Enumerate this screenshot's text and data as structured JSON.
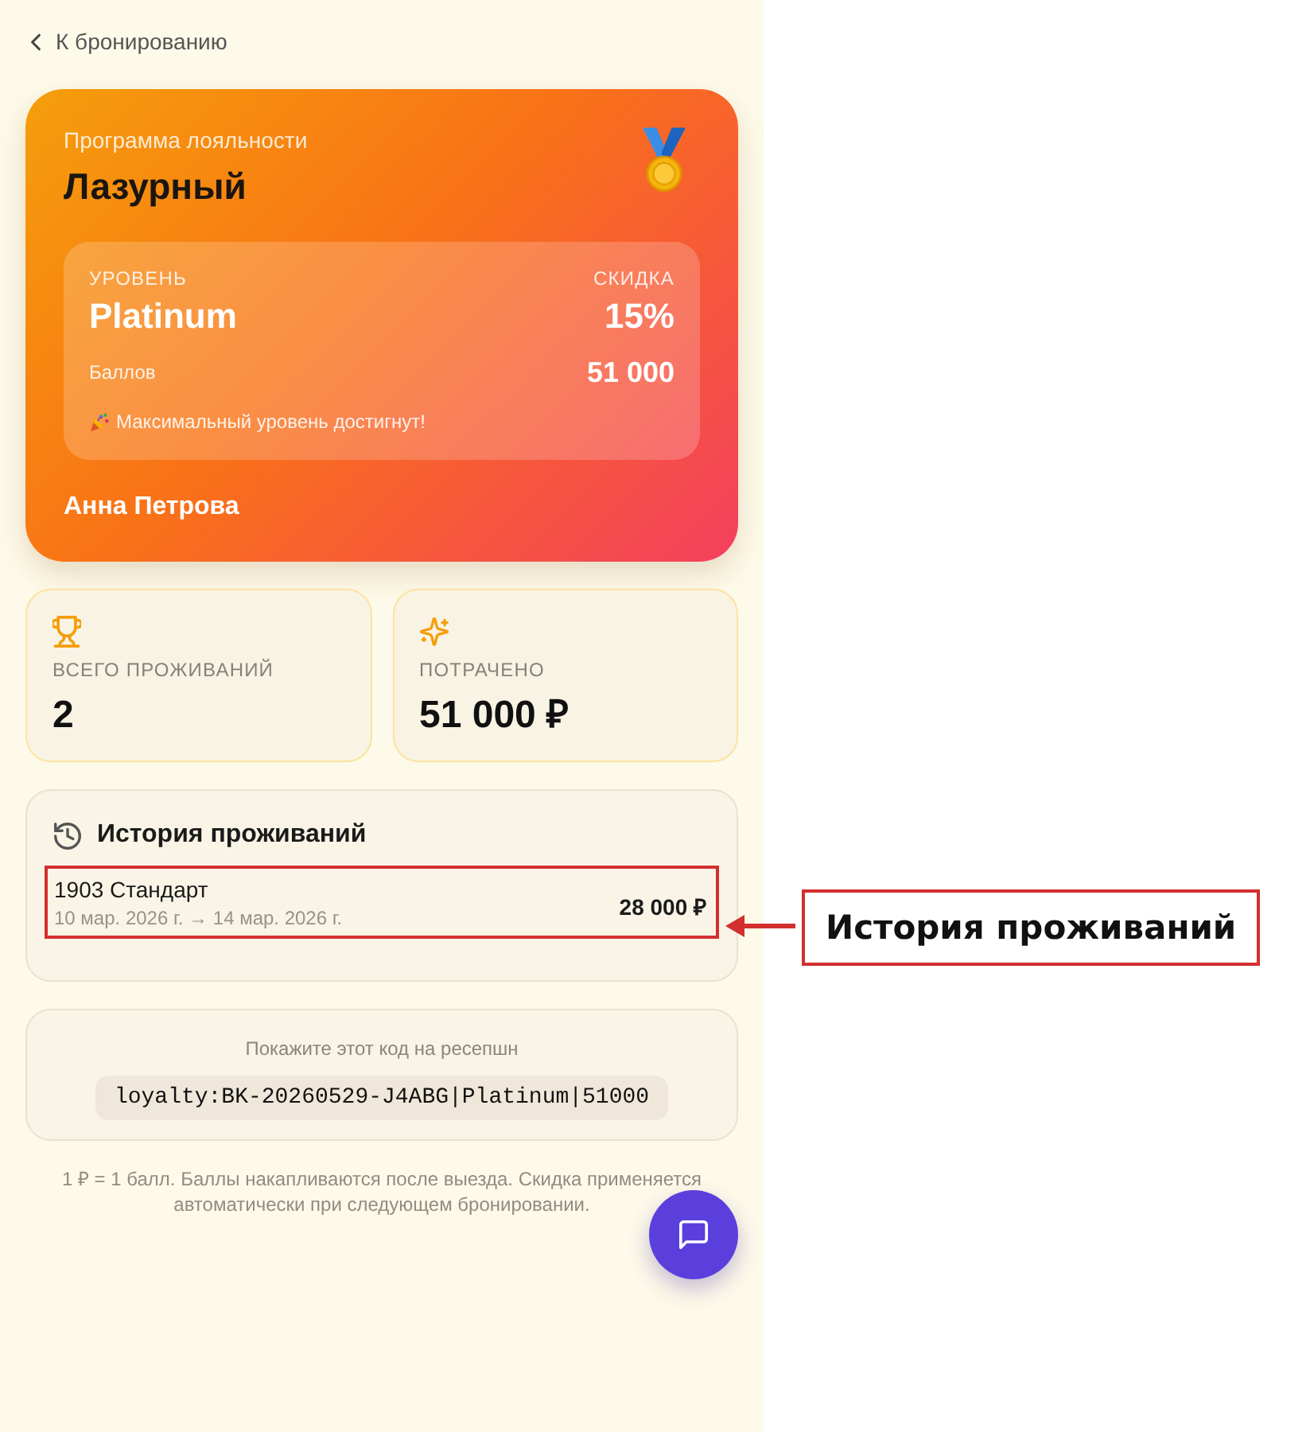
{
  "back_link": {
    "label": "К бронированию"
  },
  "loyalty_card": {
    "program_label": "Программа лояльности",
    "program_name": "Лазурный",
    "level_label": "УРОВЕНЬ",
    "level": "Platinum",
    "discount_label": "СКИДКА",
    "discount": "15%",
    "points_label": "Баллов",
    "points": "51 000",
    "status_message": "Максимальный уровень достигнут!",
    "holder_name": "Анна Петрова"
  },
  "stats": [
    {
      "kind": "trophy",
      "label": "ВСЕГО ПРОЖИВАНИЙ",
      "value": "2"
    },
    {
      "kind": "sparkle",
      "label": "ПОТРАЧЕНО",
      "value": "51 000 ₽"
    }
  ],
  "history": {
    "title": "История проживаний",
    "stays": [
      {
        "room": "1903 Стандарт",
        "dates": "10 мар. 2026 г. → 14 мар. 2026 г.",
        "amount": "28 000 ₽",
        "highlighted": true
      }
    ]
  },
  "checkin_code": {
    "hint": "Покажите этот код на ресепшн",
    "code": "loyalty:BK-20260529-J4ABG|Platinum|51000"
  },
  "footnote": "1 ₽ = 1 балл. Баллы накапливаются после выезда. Скидка применяется автоматически при следующем бронировании.",
  "annotation": {
    "label": "История проживаний"
  }
}
